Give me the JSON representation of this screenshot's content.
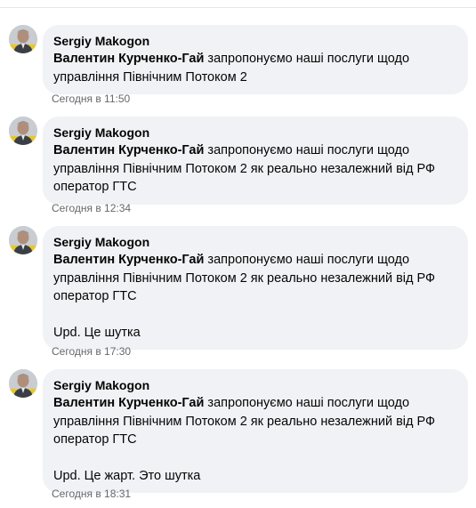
{
  "comments": [
    {
      "author": "Sergiy Makogon",
      "mention": "Валентин Курченко-Гай",
      "text": " запропонуємо наші послуги щодо управління Північним Потоком 2",
      "upd": "",
      "time": "Сегодня в 11:50"
    },
    {
      "author": "Sergiy Makogon",
      "mention": "Валентин Курченко-Гай",
      "text": " запропонуємо наші послуги щодо управління Північним Потоком 2 як реально незалежний від РФ оператор ГТС",
      "upd": "",
      "time": "Сегодня в 12:34"
    },
    {
      "author": "Sergiy Makogon",
      "mention": "Валентин Курченко-Гай",
      "text": " запропонуємо наші послуги щодо управління Північним Потоком 2 як реально незалежний від РФ оператор ГТС",
      "upd": "Upd. Це шутка",
      "time": "Сегодня в 17:30"
    },
    {
      "author": "Sergiy Makogon",
      "mention": "Валентин Курченко-Гай",
      "text": " запропонуємо наші послуги щодо управління Північним Потоком 2 як реально незалежний від РФ оператор ГТС",
      "upd": "Upd. Це жарт. Это шутка",
      "time": "Сегодня в 18:31"
    }
  ],
  "colors": {
    "bubble": "#f0f2f5",
    "timestamp": "#65676b",
    "text": "#050505"
  }
}
